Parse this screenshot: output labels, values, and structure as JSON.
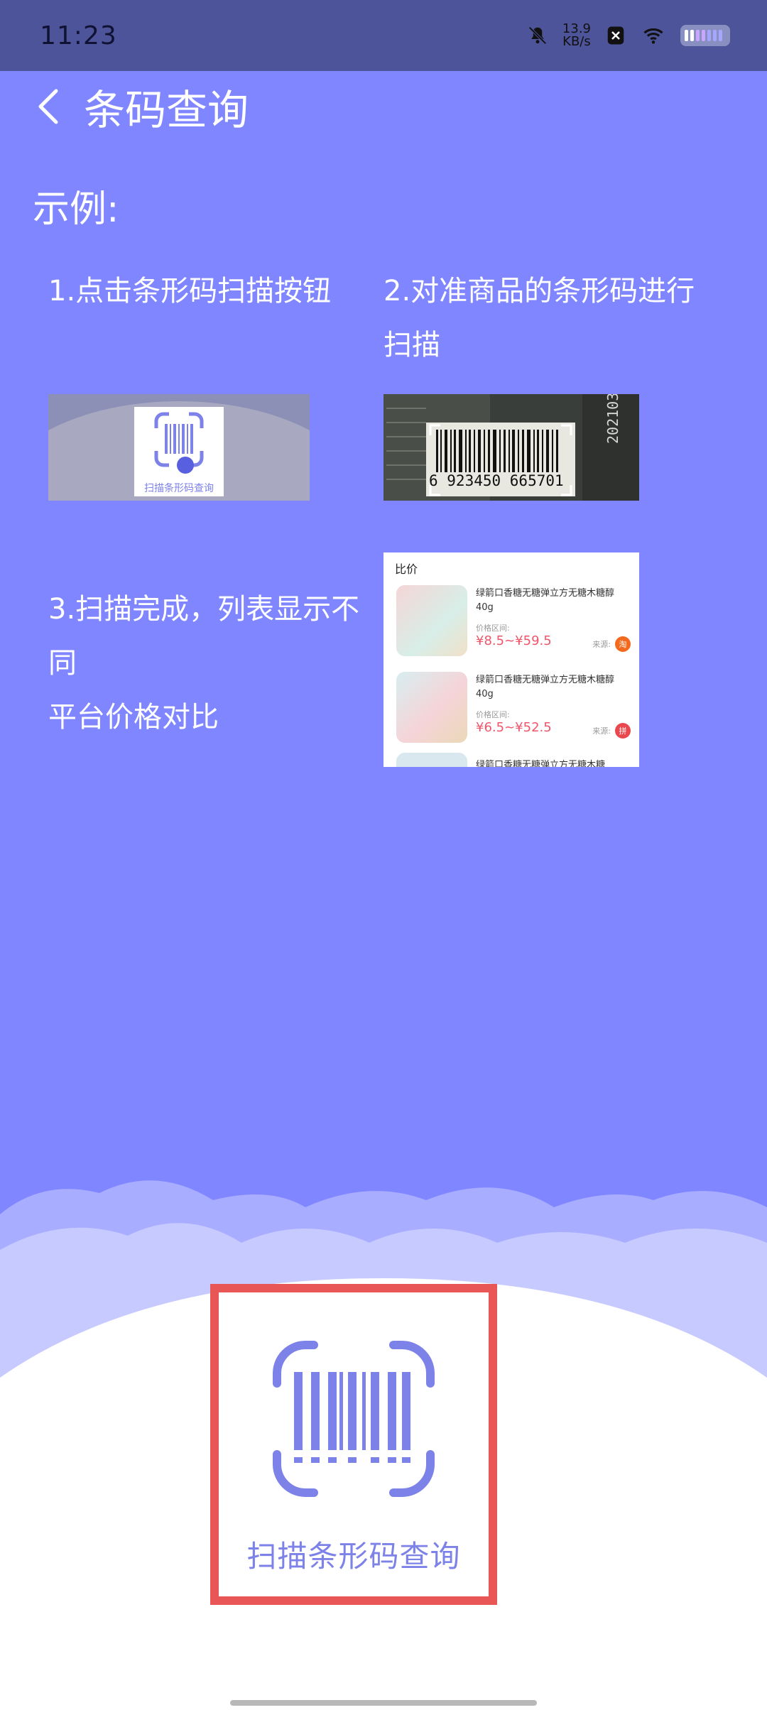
{
  "status_bar": {
    "time": "11:23",
    "net_speed_value": "13.9",
    "net_speed_unit": "KB/s"
  },
  "header": {
    "back_icon": "chevron-left-icon",
    "title": "条码查询"
  },
  "example": {
    "title": "示例:",
    "step1": "1.点击条形码扫描按钮",
    "step2_line1": "2.对准商品的条形码进行",
    "step2_line2": "扫描",
    "step3_line1": "3.扫描完成，列表显示不",
    "step3_line2": "同",
    "step3_line3": "平台价格对比"
  },
  "thumb1": {
    "label": "扫描条形码查询"
  },
  "thumb2": {
    "barcode_number": "6 923450 665701"
  },
  "thumb3": {
    "title": "比价",
    "items": [
      {
        "name": "绿箭口香糖无糖弹立方无糖木糖醇40g",
        "range_label": "价格区间:",
        "price": "¥8.5~¥59.5",
        "source_label": "来源:",
        "source_icon": "淘"
      },
      {
        "name": "绿箭口香糖无糖弹立方无糖木糖醇40g",
        "range_label": "价格区间:",
        "price": "¥6.5~¥52.5",
        "source_label": "来源:",
        "source_icon": "拼"
      }
    ],
    "partial_item_name": "绿箭口香糖无糖弹立方无糖木糖"
  },
  "scan_button": {
    "label": "扫描条形码查询",
    "icon": "barcode-scan-icon"
  },
  "colors": {
    "background": "#7F86FF",
    "status_bar": "#4D5499",
    "accent": "#7D82E8",
    "highlight": "#E85656"
  }
}
